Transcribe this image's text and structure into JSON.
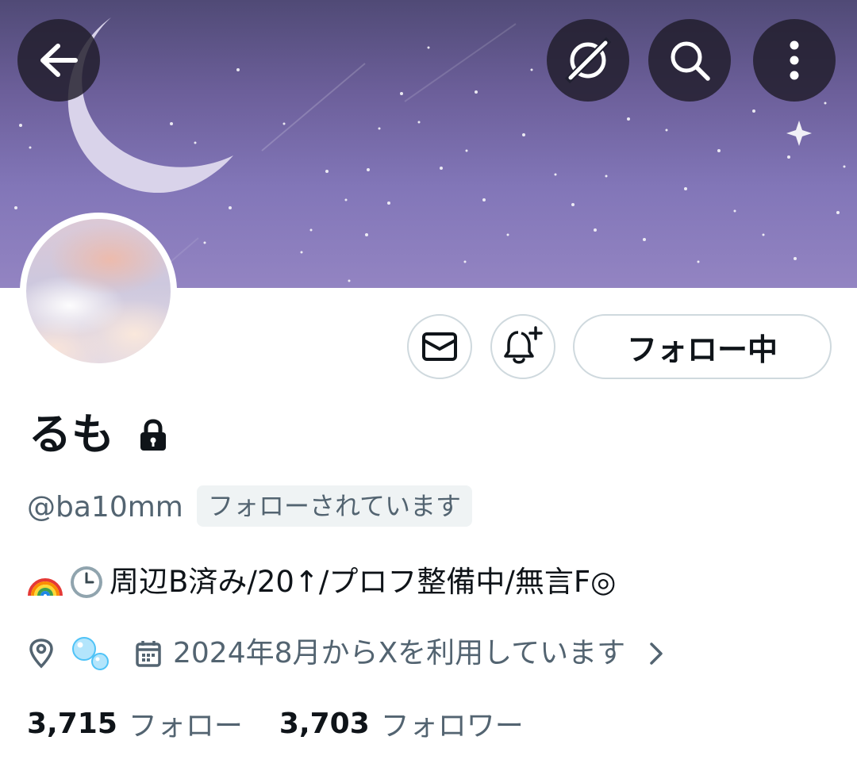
{
  "profile": {
    "display_name": "るも",
    "handle": "@ba10mm",
    "follows_you_label": "フォローされています",
    "bio": "周辺B済み/20↑/プロフ整備中/無言F◎",
    "bio_emojis": [
      "rainbow-emoji",
      "clock-emoji"
    ],
    "location_emoji": "bubbles-emoji",
    "joined": "2024年8月からXを利用しています",
    "following_count": "3,715",
    "following_label": "フォロー",
    "followers_count": "3,703",
    "followers_label": "フォロワー"
  },
  "actions": {
    "follow_label": "フォロー中"
  },
  "icons": {
    "back": "arrow-left-icon",
    "grok": "grok-icon",
    "search": "search-icon",
    "more": "more-vertical-icon",
    "dm": "mail-icon",
    "notify": "bell-plus-icon",
    "lock": "lock-icon",
    "location": "location-pin-icon",
    "calendar": "calendar-icon",
    "chevron": "chevron-right-icon"
  },
  "colors": {
    "primary_text": "#0f1419",
    "secondary_text": "#536471",
    "border": "#cfd9de",
    "banner_top": "#504a76",
    "banner_bottom": "#9384c2"
  }
}
